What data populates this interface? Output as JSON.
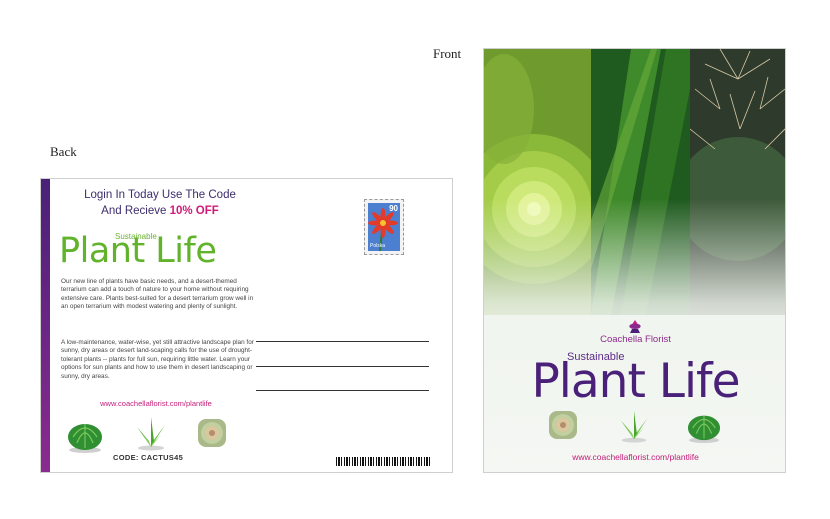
{
  "labels": {
    "back": "Back",
    "front": "Front"
  },
  "back": {
    "promo_line1": "Login In Today Use The Code",
    "promo_line2": "And Recieve",
    "promo_highlight": "10% OFF",
    "sustainable": "Sustainable",
    "title": "Plant Life",
    "paragraph1": "Our new line of plants have basic needs, and a desert-themed terrarium can add a touch of nature to your home without requiring extensive care. Plants best-suited for a desert terrarium grow well in an open terrarium with modest watering and plenty of sunlight.",
    "paragraph2": "A low-maintenance, water-wise, yet still attractive landscape plan for sunny, dry areas or desert land-scaping calls for the use of drought-tolerant plants -- plants for full sun, requiring little water. Learn your options for sun plants and how to use them in desert landscaping or sunny, dry areas.",
    "url": "www.coachellaflorist.com/plantlife",
    "code": "CODE: CACTUS45",
    "stamp_value": "90",
    "stamp_country": "Polska"
  },
  "front": {
    "brand": "Coachella Florist",
    "sustainable": "Sustainable",
    "title": "Plant Life",
    "url": "www.coachellaflorist.com/plantlife"
  },
  "colors": {
    "purple": "#4a2178",
    "magenta": "#c51d7a",
    "green": "#62b32c"
  },
  "icons": [
    "cactus-icon",
    "aloe-icon",
    "succulent-icon",
    "flower-logo-icon"
  ]
}
